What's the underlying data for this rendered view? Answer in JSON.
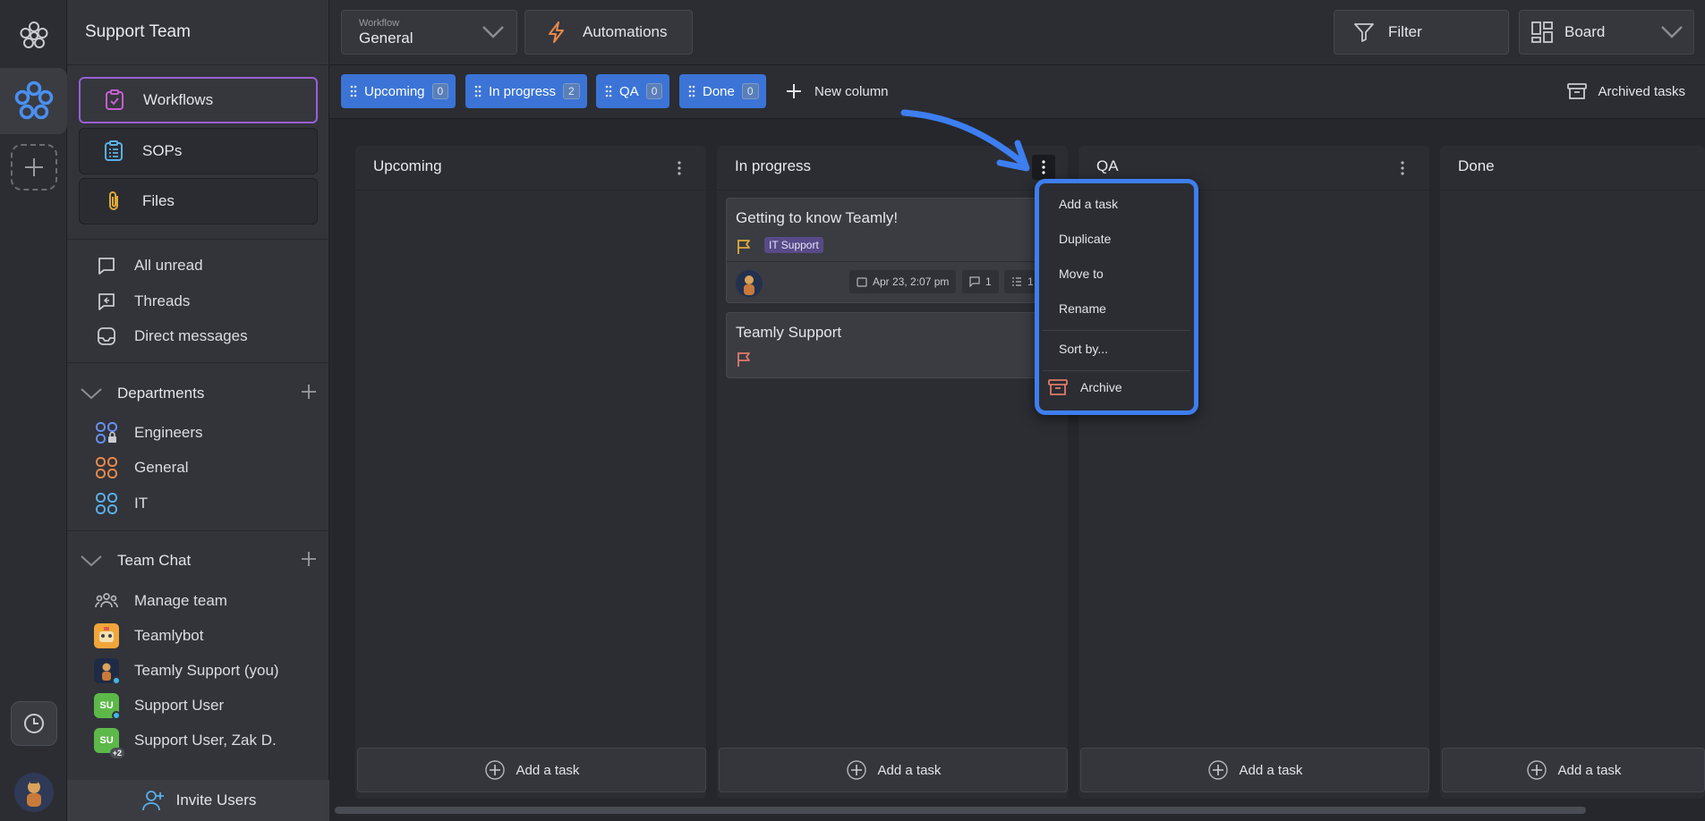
{
  "sidebar": {
    "team_title": "Support Team",
    "primary": [
      {
        "label": "Workflows"
      },
      {
        "label": "SOPs"
      },
      {
        "label": "Files"
      }
    ],
    "messages": [
      {
        "label": "All unread"
      },
      {
        "label": "Threads"
      },
      {
        "label": "Direct messages"
      }
    ],
    "departments": {
      "title": "Departments",
      "items": [
        {
          "label": "Engineers"
        },
        {
          "label": "General"
        },
        {
          "label": "IT"
        }
      ]
    },
    "team_chat": {
      "title": "Team Chat",
      "items": [
        {
          "label": "Manage team"
        },
        {
          "label": "Teamlybot"
        },
        {
          "label": "Teamly Support (you)"
        },
        {
          "label": "Support User",
          "initials": "SU"
        },
        {
          "label": "Support User, Zak D.",
          "initials": "SU",
          "extra": "+2"
        }
      ]
    },
    "invite_label": "Invite Users"
  },
  "topbar": {
    "workflow_caption": "Workflow",
    "workflow_value": "General",
    "automations_label": "Automations",
    "filter_label": "Filter",
    "view_label": "Board"
  },
  "chips": [
    {
      "label": "Upcoming",
      "count": "0"
    },
    {
      "label": "In progress",
      "count": "2"
    },
    {
      "label": "QA",
      "count": "0"
    },
    {
      "label": "Done",
      "count": "0"
    }
  ],
  "new_column_label": "New column",
  "archived_label": "Archived tasks",
  "columns": [
    {
      "title": "Upcoming",
      "add_label": "Add a task"
    },
    {
      "title": "In progress",
      "add_label": "Add a task"
    },
    {
      "title": "QA",
      "add_label": "Add a task"
    },
    {
      "title": "Done",
      "add_label": "Add a task"
    }
  ],
  "cards": [
    {
      "title": "Getting to know Teamly!",
      "tag": "IT Support",
      "date": "Apr 23, 2:07 pm",
      "comments": "1",
      "subtasks": "1"
    },
    {
      "title": "Teamly Support"
    }
  ],
  "menu": {
    "items": [
      "Add a task",
      "Duplicate",
      "Move to",
      "Rename"
    ],
    "sort": "Sort by...",
    "archive": "Archive"
  },
  "colors": {
    "accent": "#3b74d6",
    "highlight": "#3d7ef0",
    "active_border": "#9a5fd6",
    "flag": "#e07a6a",
    "tag_bg": "#574a87"
  }
}
